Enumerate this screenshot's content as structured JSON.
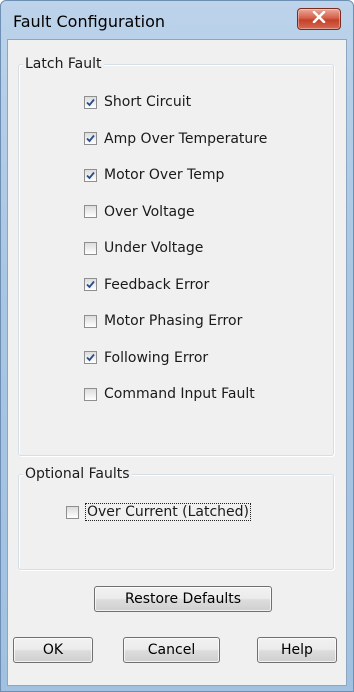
{
  "window": {
    "title": "Fault Configuration",
    "close_icon": "close-icon"
  },
  "latch_fault": {
    "legend": "Latch Fault",
    "items": [
      {
        "label": "Short Circuit",
        "checked": true
      },
      {
        "label": "Amp Over Temperature",
        "checked": true
      },
      {
        "label": "Motor Over Temp",
        "checked": true
      },
      {
        "label": "Over Voltage",
        "checked": false
      },
      {
        "label": "Under Voltage",
        "checked": false
      },
      {
        "label": "Feedback Error",
        "checked": true
      },
      {
        "label": "Motor Phasing Error",
        "checked": false
      },
      {
        "label": "Following Error",
        "checked": true
      },
      {
        "label": "Command Input Fault",
        "checked": false
      }
    ]
  },
  "optional_faults": {
    "legend": "Optional Faults",
    "items": [
      {
        "label": "Over Current (Latched)",
        "checked": false
      }
    ]
  },
  "buttons": {
    "restore_defaults": "Restore Defaults",
    "ok": "OK",
    "cancel": "Cancel",
    "help": "Help"
  },
  "colors": {
    "title_bar": "#a9c6e3",
    "close_button": "#c4402a",
    "dialog_background": "#f0f0f0",
    "check_mark": "#2a4d8a"
  }
}
